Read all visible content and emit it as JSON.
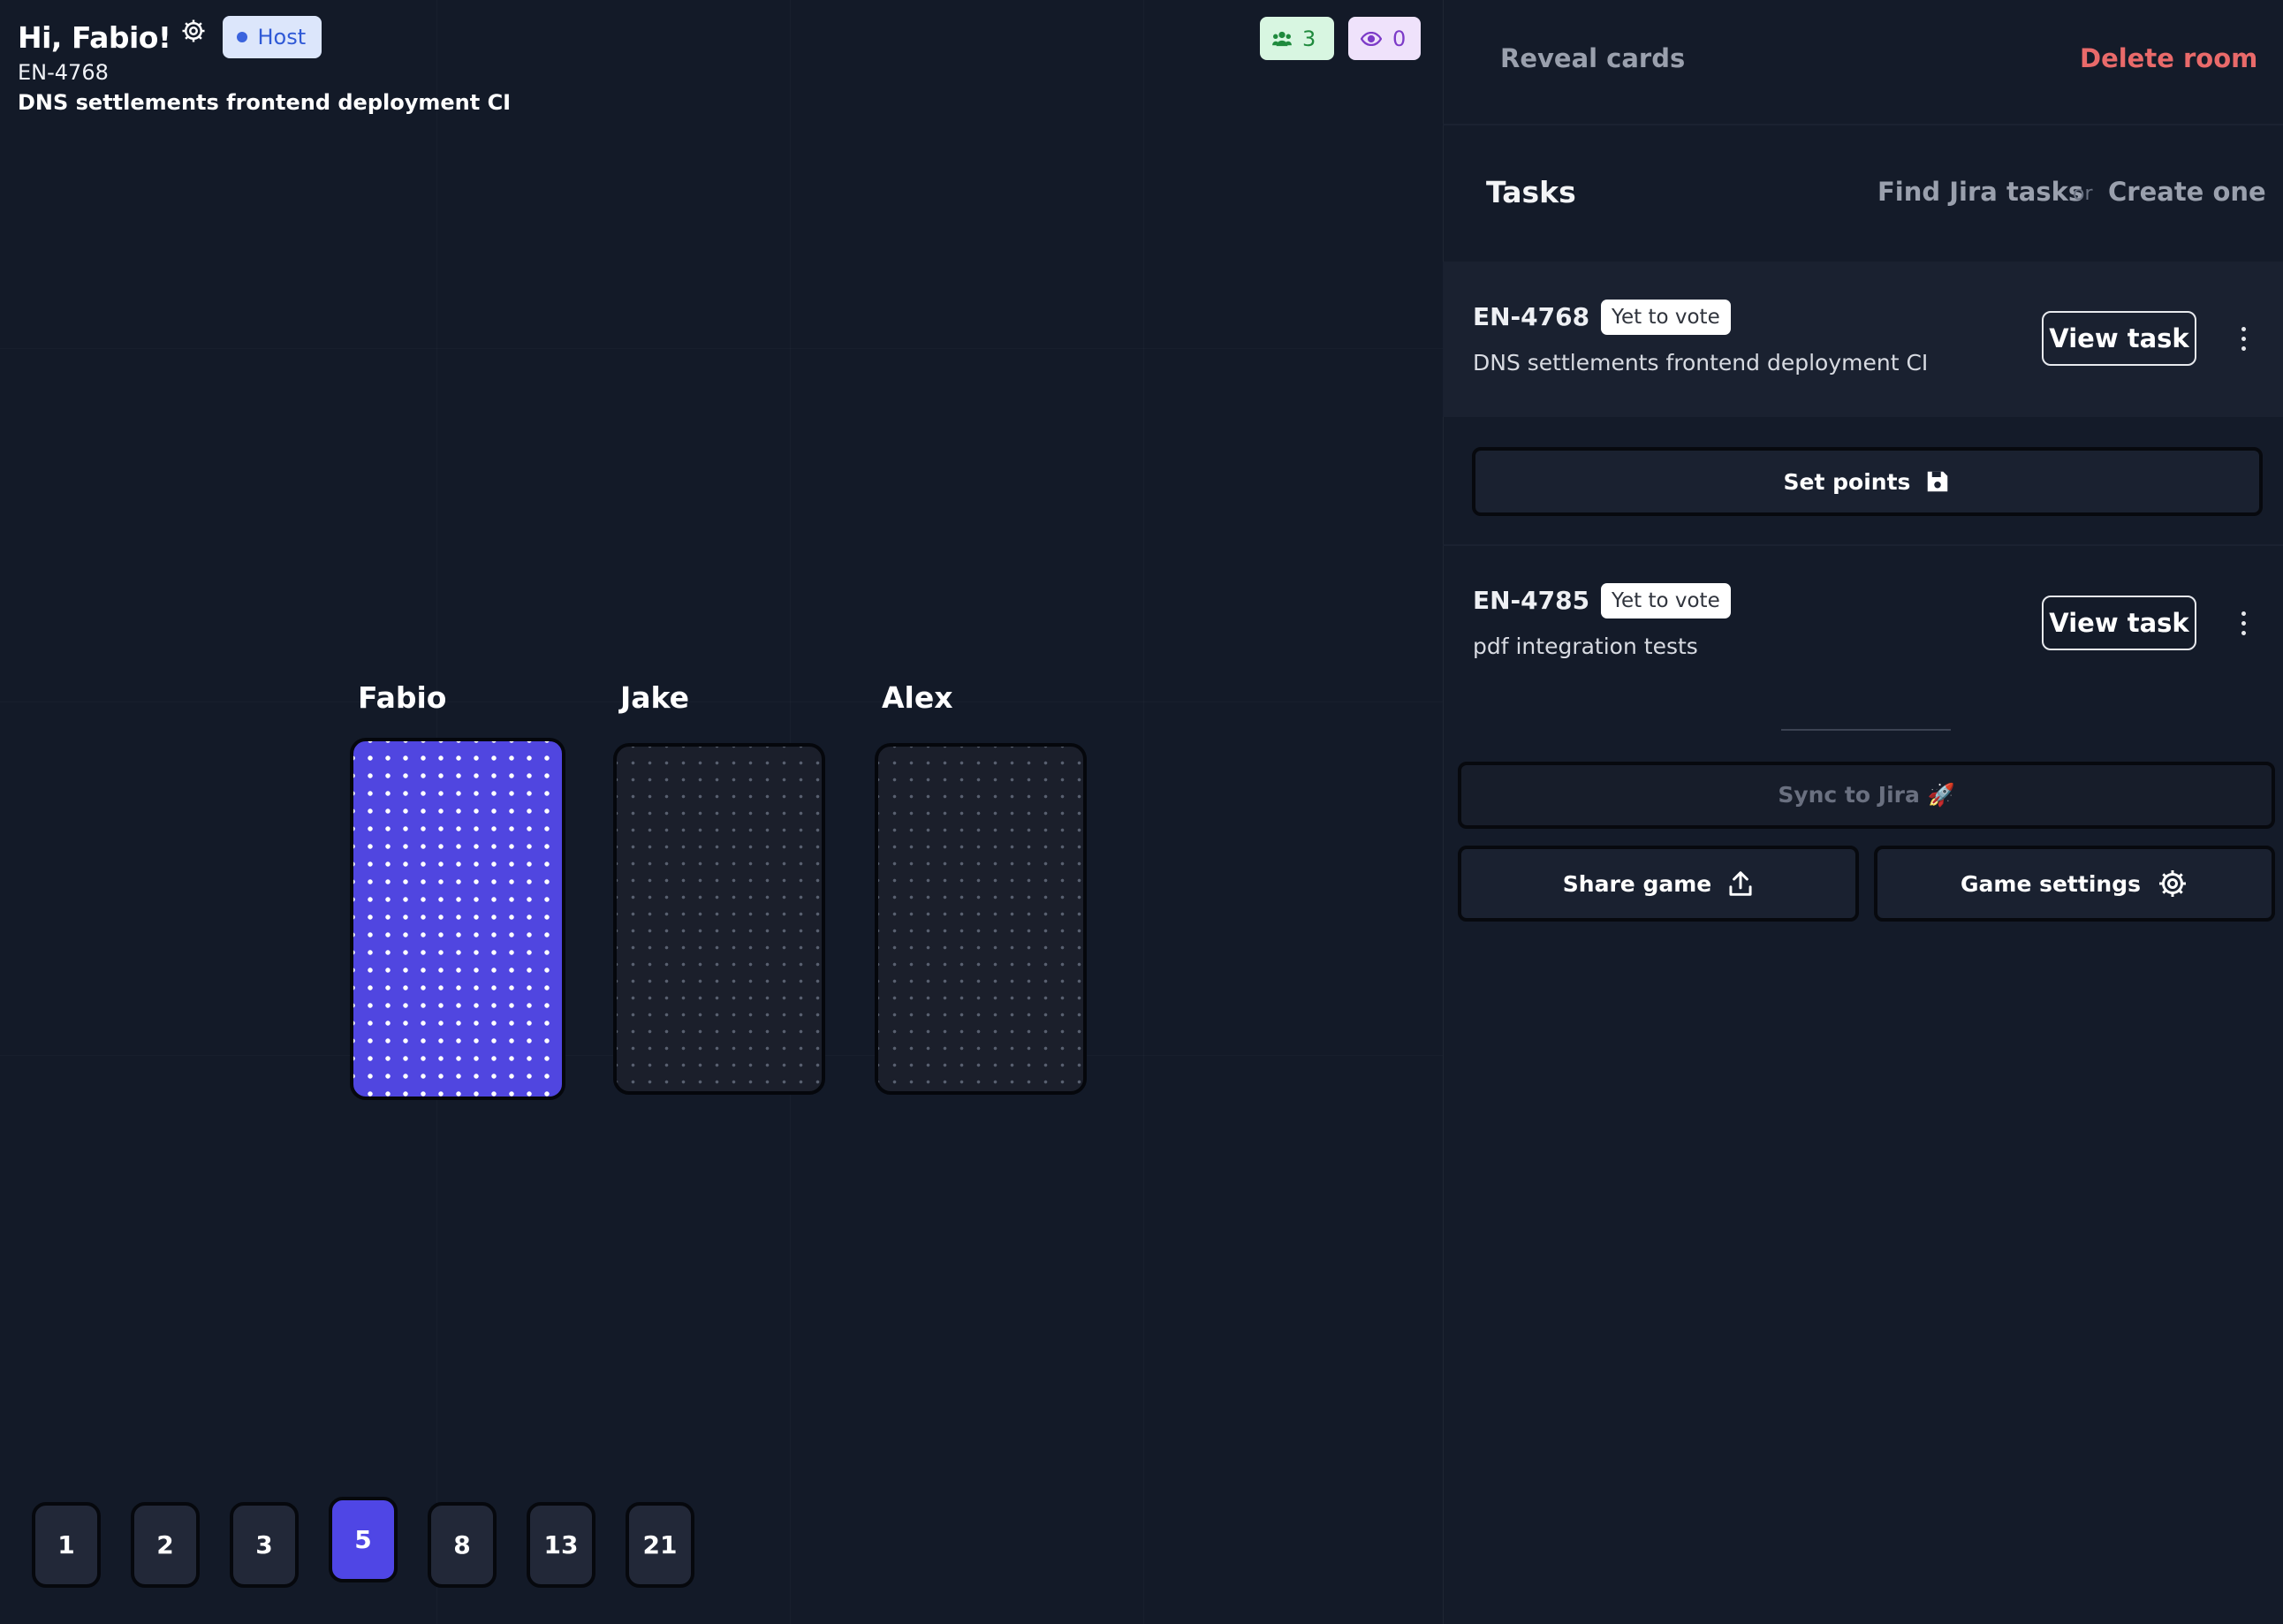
{
  "header": {
    "greeting": "Hi, Fabio!",
    "role_badge": "Host",
    "task_code": "EN-4768",
    "task_title": "DNS settlements frontend deployment CI",
    "players_count": "3",
    "spectators_count": "0"
  },
  "players": [
    {
      "name": "Fabio"
    },
    {
      "name": "Jake"
    },
    {
      "name": "Alex"
    }
  ],
  "vote_options": [
    "1",
    "2",
    "3",
    "5",
    "8",
    "13",
    "21"
  ],
  "selected_vote": "5",
  "panel": {
    "reveal_label": "Reveal cards",
    "delete_label": "Delete room",
    "tasks_heading": "Tasks",
    "find_jira": "Find Jira tasks",
    "or_text": "or",
    "create_one": "Create one",
    "tasks": [
      {
        "code": "EN-4768",
        "status": "Yet to vote",
        "title": "DNS settlements frontend deployment CI",
        "view_label": "View task"
      },
      {
        "code": "EN-4785",
        "status": "Yet to vote",
        "title": "pdf integration tests",
        "view_label": "View task"
      }
    ],
    "set_points": "Set points",
    "sync_jira": "Sync to Jira 🚀",
    "share_game": "Share game",
    "game_settings": "Game settings"
  },
  "colors": {
    "background": "#131a28",
    "accent": "#4f46e5",
    "delete": "#e96a6a",
    "host_badge_bg": "#dce6fb"
  }
}
